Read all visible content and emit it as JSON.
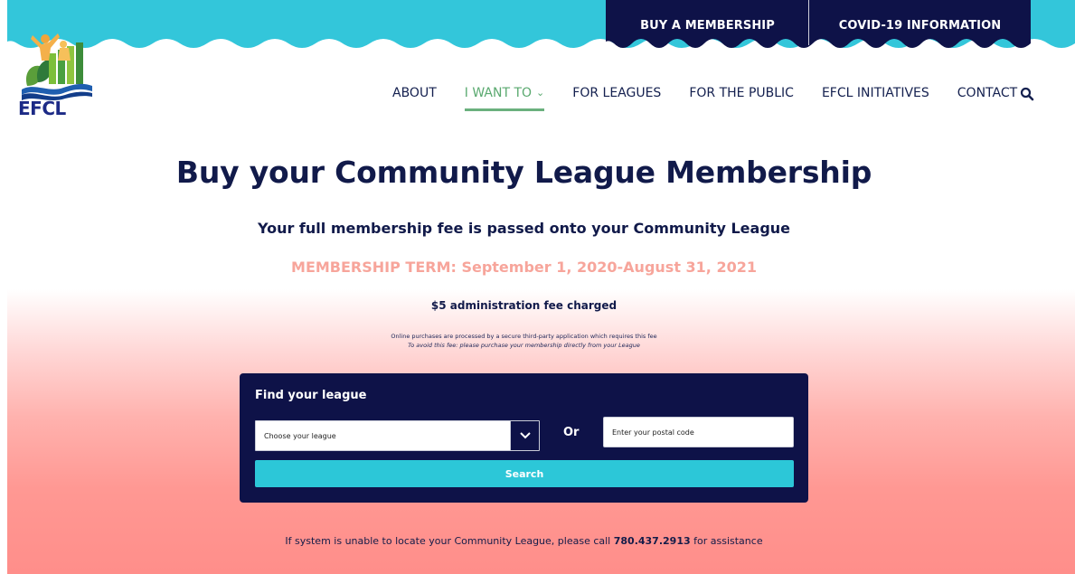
{
  "colors": {
    "wave_teal": "#33c6da",
    "navy": "#0e1248",
    "nav_active_green": "#5aa96f",
    "term_pink": "#f7a59b",
    "search_button": "#2cc7d8",
    "gradient_end": "#ff8e8a"
  },
  "header": {
    "logo_text": "EFCL",
    "top_links": [
      {
        "label": "BUY A MEMBERSHIP"
      },
      {
        "label": "COVID-19 INFORMATION"
      }
    ],
    "nav": [
      {
        "label": "ABOUT",
        "active": false
      },
      {
        "label": "I WANT TO",
        "active": true,
        "has_dropdown": true
      },
      {
        "label": "FOR LEAGUES",
        "active": false
      },
      {
        "label": "FOR THE PUBLIC",
        "active": false
      },
      {
        "label": "EFCL INITIATIVES",
        "active": false
      },
      {
        "label": "CONTACT",
        "active": false
      }
    ],
    "search_icon": "search-icon"
  },
  "main": {
    "title": "Buy your Community League Membership",
    "subtitle": "Your full membership fee is passed onto your Community League",
    "term": "MEMBERSHIP TERM: September 1, 2020-August 31, 2021",
    "admin_fee": "$5 administration fee charged",
    "fine_print_1": "Online purchases are processed by a secure third-party application which requires this fee",
    "fine_print_2": "To avoid this fee: please purchase your membership directly from your League"
  },
  "finder": {
    "title": "Find your league",
    "select_value": "Choose your league",
    "or_label": "Or",
    "postal_placeholder": "Enter your postal code",
    "postal_value": "",
    "search_label": "Search"
  },
  "footer": {
    "assist_before": "If system is unable to locate your Community League, please call ",
    "phone": "780.437.2913",
    "assist_after": " for assistance"
  }
}
